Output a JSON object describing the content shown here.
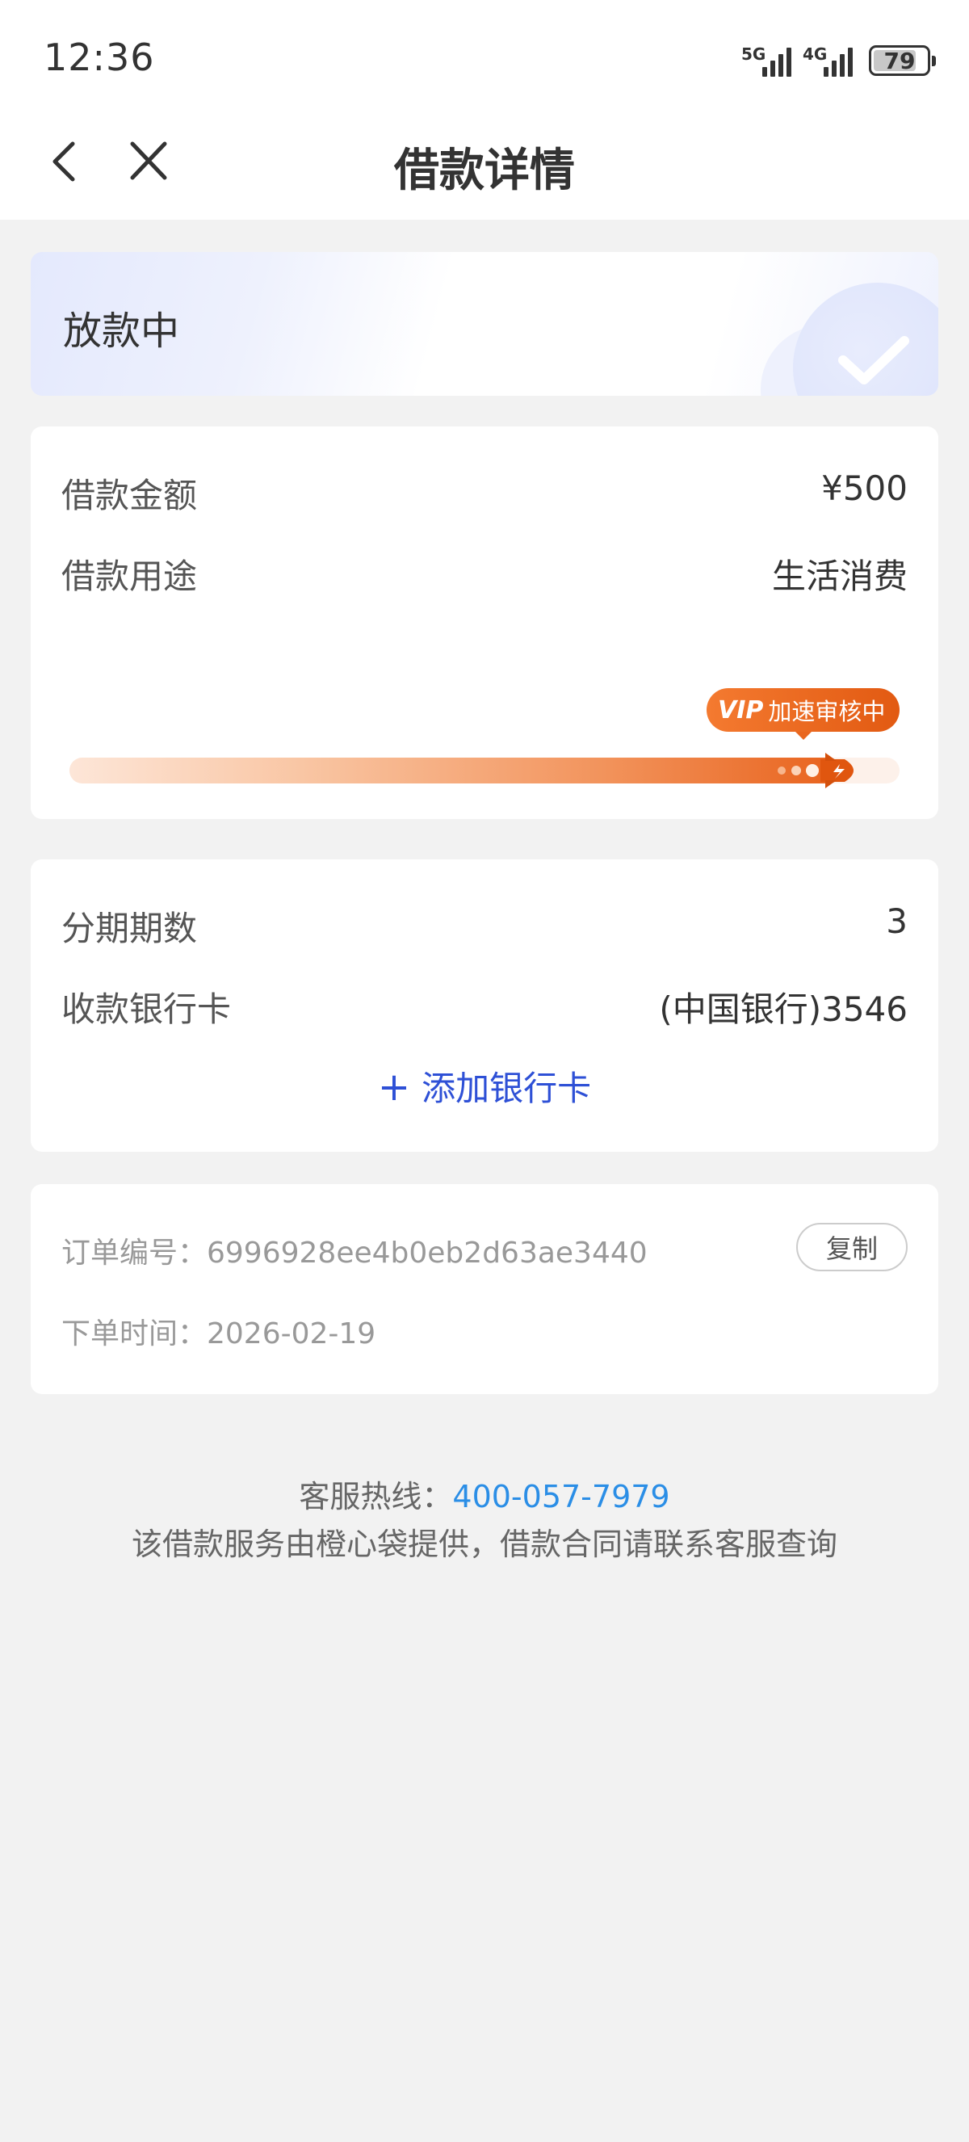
{
  "status_bar": {
    "time": "12:36",
    "signal_1": "5G",
    "signal_2": "4G",
    "battery": "79"
  },
  "nav": {
    "title": "借款详情",
    "back_icon": "chevron-left-icon",
    "close_icon": "close-icon"
  },
  "banner": {
    "status_text": "放款中",
    "icon": "check-icon"
  },
  "loan": {
    "amount_label": "借款金额",
    "amount_value": "¥500",
    "purpose_label": "借款用途",
    "purpose_value": "生活消费",
    "progress": {
      "badge_mark": "VIP",
      "badge_text": "加速审核中",
      "fraction": 0.93
    }
  },
  "bank": {
    "installments_label": "分期期数",
    "installments_value": "3",
    "card_label": "收款银行卡",
    "card_value": "(中国银行)3546",
    "add_card_label": "添加银行卡"
  },
  "order": {
    "id_line": "订单编号：6996928ee4b0eb2d63ae3440",
    "copy_label": "复制",
    "time_line": "下单时间：2026-02-19"
  },
  "footer": {
    "hotline_label": "客服热线：",
    "hotline_number": "400-057-7979",
    "note": "该借款服务由橙心袋提供，借款合同请联系客服查询"
  },
  "colors": {
    "accent_blue": "#2e50d6",
    "link_blue": "#2b8ee6",
    "progress_orange": "#e8621c",
    "background": "#f2f2f2"
  }
}
